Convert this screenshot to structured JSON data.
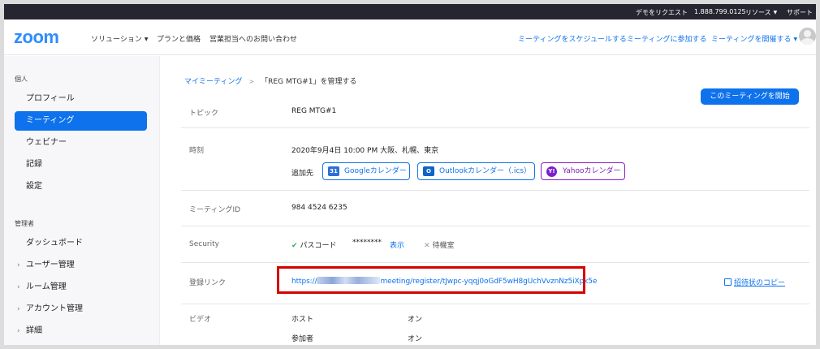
{
  "topbar": {
    "demo": "デモをリクエスト",
    "phone": "1.888.799.0125",
    "resources": "リソース",
    "support": "サポート"
  },
  "header": {
    "logo": "zoom",
    "nav_left": [
      "ソリューション",
      "プランと価格",
      "営業担当へのお問い合わせ"
    ],
    "nav_right": [
      "ミーティングをスケジュールする",
      "ミーティングに参加する",
      "ミーティングを開催する"
    ]
  },
  "sidebar": {
    "personal_header": "個人",
    "personal_items": [
      "プロフィール",
      "ミーティング",
      "ウェビナー",
      "記録",
      "設定"
    ],
    "admin_header": "管理者",
    "admin_items": [
      "ダッシュボード",
      "ユーザー管理",
      "ルーム管理",
      "アカウント管理",
      "詳細"
    ]
  },
  "breadcrumb": {
    "parent": "マイミーティング",
    "separator": ">",
    "current": "「REG MTG#1」を管理する"
  },
  "start_button": "このミーティングを開始",
  "topic": {
    "label": "トピック",
    "value": "REG MTG#1"
  },
  "time": {
    "label": "時刻",
    "value": "2020年9月4日 10:00 PM 大阪、札幌、東京",
    "add_to_label": "追加先",
    "calendars": [
      "Googleカレンダー",
      "Outlookカレンダー（.ics）",
      "Yahooカレンダー"
    ],
    "calendar_icons": [
      "31",
      "O",
      "Y!"
    ]
  },
  "meeting_id": {
    "label": "ミーティングID",
    "value": "984 4524 6235"
  },
  "security": {
    "label": "Security",
    "passcode_label": "パスコード",
    "passcode_mask": "********",
    "show": "表示",
    "waiting_room": "待機室"
  },
  "registration": {
    "label": "登録リンク",
    "link_prefix": "https://",
    "link_suffix": "meeting/register/tJwpc-yqqj0oGdF5wH8gUchVvznNz5iXpk5e",
    "copy": "招待状のコピー"
  },
  "video": {
    "label": "ビデオ",
    "host_label": "ホスト",
    "host_value": "オン",
    "participant_label": "参加者",
    "participant_value": "オン"
  },
  "colors": {
    "accent": "#0e72ed",
    "topbar": "#262631",
    "highlight": "#d60000",
    "yahoo": "#7b1fcf"
  }
}
